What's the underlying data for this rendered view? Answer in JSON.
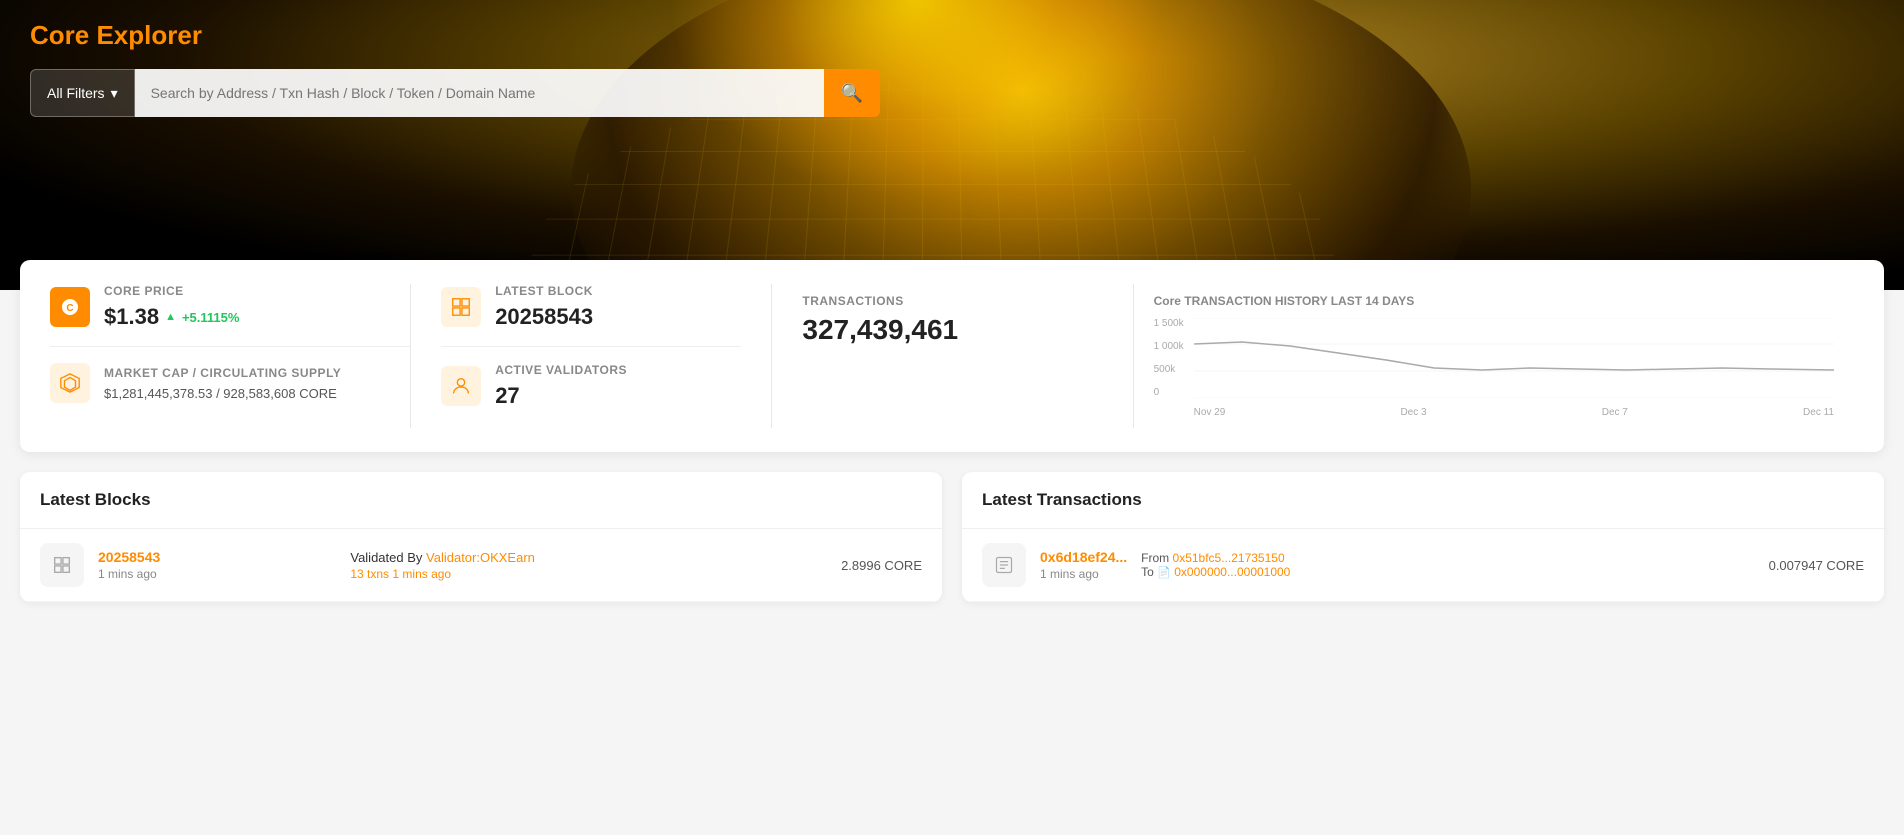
{
  "app": {
    "title": "Core Explorer"
  },
  "search": {
    "filter_label": "All Filters",
    "placeholder": "Search by Address / Txn Hash / Block / Token / Domain Name"
  },
  "stats": {
    "price_label": "CORE PRICE",
    "price_value": "$1.38",
    "price_change": "+5.1115%",
    "latest_block_label": "LATEST BLOCK",
    "latest_block_value": "20258543",
    "transactions_label": "TRANSACTIONS",
    "transactions_value": "327,439,461",
    "market_cap_label": "MARKET CAP / CIRCULATING SUPPLY",
    "market_cap_value": "$1,281,445,378.53",
    "supply_value": "928,583,608",
    "supply_unit": "CORE",
    "validators_label": "ACTIVE VALIDATORS",
    "validators_value": "27",
    "chart_title": "Core TRANSACTION HISTORY LAST 14 DAYS"
  },
  "chart": {
    "y_labels": [
      "1 500k",
      "1 000k",
      "500k",
      "0"
    ],
    "x_labels": [
      "Nov 29",
      "Dec 3",
      "Dec 7",
      "Dec 11"
    ]
  },
  "latest_blocks": {
    "title": "Latest Blocks",
    "items": [
      {
        "number": "20258543",
        "time": "1 mins ago",
        "validated_by_label": "Validated By",
        "validator": "Validator:OKXEarn",
        "txns": "13 txns",
        "txns_time": "1 mins ago",
        "reward": "2.8996 CORE"
      }
    ]
  },
  "latest_transactions": {
    "title": "Latest Transactions",
    "items": [
      {
        "hash": "0x6d18ef24...",
        "time": "1 mins ago",
        "from_label": "From",
        "from_addr": "0x51bfc5...21735150",
        "to_label": "To",
        "to_addr": "0x000000...00001000",
        "amount": "0.007947 CORE"
      }
    ]
  }
}
